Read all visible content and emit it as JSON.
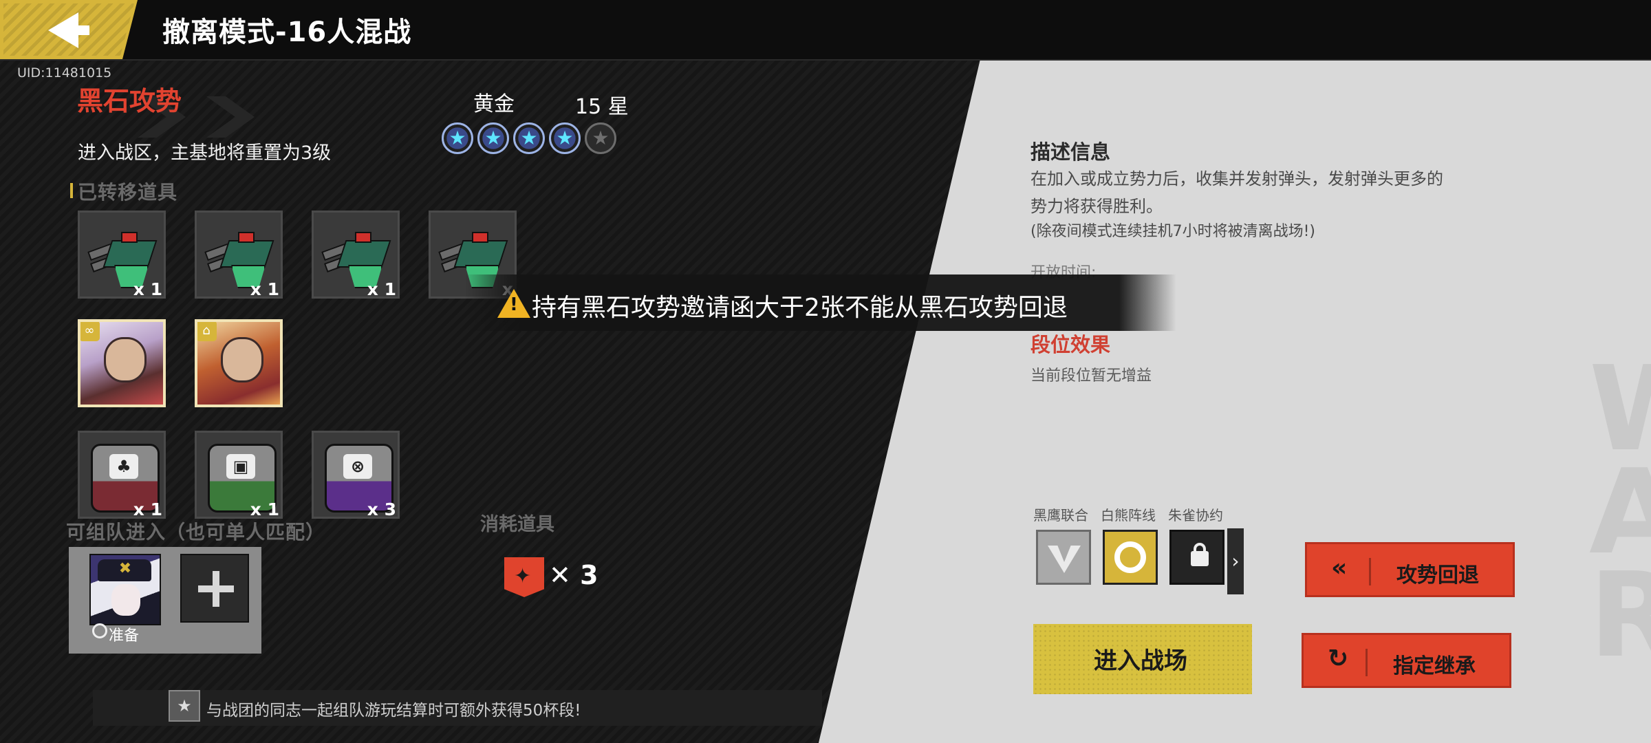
{
  "header": {
    "title": "撤离模式-16人混战"
  },
  "uid": "UID:11481015",
  "mode": {
    "name": "黑石攻势",
    "description": "进入战区，主基地将重置为3级",
    "rank_name": "黄金",
    "rank_stars_text": "15 星",
    "stars_filled": 4,
    "stars_total": 5
  },
  "transferred_items": {
    "label": "已转移道具",
    "weapons": [
      {
        "qty": "x 1"
      },
      {
        "qty": "x 1"
      },
      {
        "qty": "x 1"
      },
      {
        "qty": "x"
      }
    ],
    "boxes": [
      {
        "qty": "x 1",
        "color": "#7a2b33"
      },
      {
        "qty": "x 1",
        "color": "#3b7a3a"
      },
      {
        "qty": "x 3",
        "color": "#5b2f8a"
      }
    ]
  },
  "team": {
    "label": "可组队进入（也可单人匹配）",
    "ready_label": "准备"
  },
  "consumables": {
    "label": "消耗道具",
    "qty": "✕ 3"
  },
  "hint": {
    "text": "与战团的同志一起组队游玩结算时可额外获得50杯段!"
  },
  "toast": {
    "text": "持有黑石攻势邀请函大于2张不能从黑石攻势回退"
  },
  "info": {
    "title": "描述信息",
    "lines": [
      "在加入或成立势力后，收集并发射弹头，发射弹头更多的",
      "势力将获得胜利。",
      "(除夜间模式连续挂机7小时将被清离战场!)"
    ],
    "open_time_label": "开放时间:",
    "rank_effect_title": "段位效果",
    "rank_effect_desc": "当前段位暂无增益"
  },
  "factions": [
    {
      "name": "黑鹰联合"
    },
    {
      "name": "白熊阵线"
    },
    {
      "name": "朱雀协约"
    }
  ],
  "buttons": {
    "enter": "进入战场",
    "retreat": "攻势回退",
    "inherit": "指定继承"
  },
  "colors": {
    "accent_gold": "#d6b53a",
    "accent_orange": "#e0432b",
    "mode_red": "#e24330"
  }
}
